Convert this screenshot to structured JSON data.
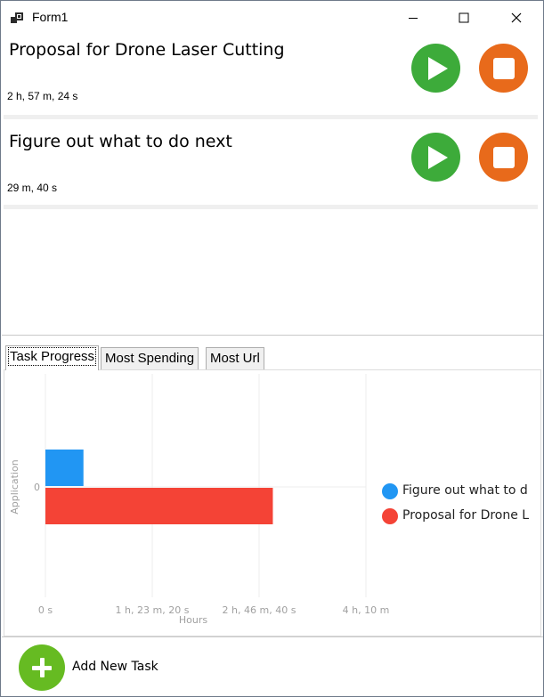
{
  "window": {
    "title": "Form1",
    "icon": "app-window-icon"
  },
  "tasks": [
    {
      "title": "Proposal for Drone Laser Cutting",
      "elapsed": "2 h, 57 m, 24 s"
    },
    {
      "title": "Figure out what to do next",
      "elapsed": "29 m, 40 s"
    }
  ],
  "colors": {
    "play": "#3dab3a",
    "stop": "#e86a1b",
    "add": "#66bb22",
    "series1": "#2196f3",
    "series2": "#f44336"
  },
  "tabs": [
    {
      "label": "Task Progress",
      "active": true
    },
    {
      "label": "Most Spending",
      "active": false
    },
    {
      "label": "Most Url",
      "active": false
    }
  ],
  "chart_data": {
    "type": "bar",
    "orientation": "horizontal",
    "categories": [
      "0"
    ],
    "ylabel": "Application",
    "xlabel": "Hours",
    "x_ticks": [
      "0 s",
      "1 h, 23 m, 20 s",
      "2 h, 46 m, 40 s",
      "4 h, 10 m"
    ],
    "x_tick_values": [
      0,
      5000,
      10000,
      15000
    ],
    "xlim": [
      0,
      15000
    ],
    "series": [
      {
        "name": "Figure out what to do next",
        "legend_label": "Figure out what to d",
        "values": [
          1780
        ],
        "color": "#2196f3"
      },
      {
        "name": "Proposal for Drone Laser Cutting",
        "legend_label": "Proposal for Drone L",
        "values": [
          10644
        ],
        "color": "#f44336"
      }
    ],
    "grid": true,
    "legend": "right"
  },
  "actions": {
    "add_task_label": "Add New Task"
  }
}
